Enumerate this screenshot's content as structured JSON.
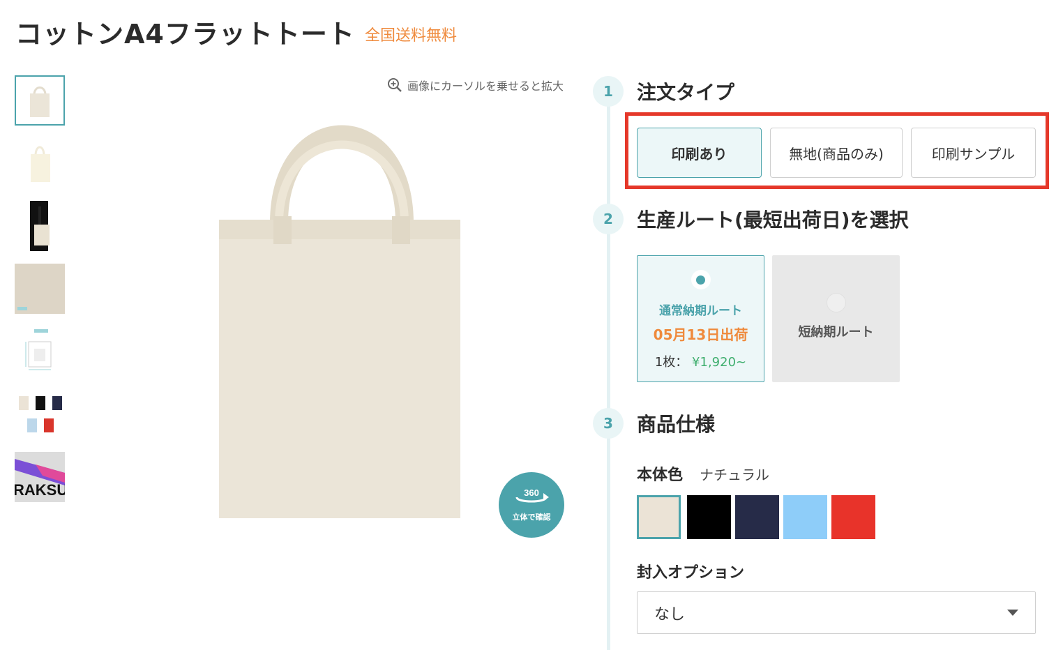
{
  "product": {
    "title": "コットンA4フラットトート",
    "shipping_badge": "全国送料無料"
  },
  "gallery": {
    "zoom_hint": "画像にカーソルを乗せると拡大",
    "btn_360_top": "360",
    "btn_360_label": "立体で確認",
    "thumbnail_watermark": "RAKSUL"
  },
  "steps": [
    {
      "number": "1",
      "title": "注文タイプ"
    },
    {
      "number": "2",
      "title": "生産ルート(最短出荷日)を選択"
    },
    {
      "number": "3",
      "title": "商品仕様"
    }
  ],
  "order_types": [
    {
      "label": "印刷あり",
      "selected": true
    },
    {
      "label": "無地(商品のみ)",
      "selected": false
    },
    {
      "label": "印刷サンプル",
      "selected": false
    }
  ],
  "routes": {
    "normal": {
      "name": "通常納期ルート",
      "date": "05月13日出荷",
      "qty_label": "1枚：",
      "price": "¥1,920~",
      "selected": true
    },
    "short": {
      "name": "短納期ルート",
      "selected": false
    }
  },
  "spec": {
    "body_color_label": "本体色",
    "body_color_value": "ナチュラル",
    "colors": [
      {
        "name": "natural",
        "hex": "#ebe3d6",
        "selected": true
      },
      {
        "name": "black",
        "hex": "#000000",
        "selected": false
      },
      {
        "name": "navy",
        "hex": "#262b48",
        "selected": false
      },
      {
        "name": "light-blue",
        "hex": "#8ecdf9",
        "selected": false
      },
      {
        "name": "red",
        "hex": "#e8332a",
        "selected": false
      }
    ],
    "insert_option_label": "封入オプション",
    "insert_option_value": "なし"
  },
  "colors": {
    "accent": "#4ba3ab",
    "orange": "#ef8a3c",
    "highlight": "#e5382a",
    "price_green": "#3fae6e"
  }
}
